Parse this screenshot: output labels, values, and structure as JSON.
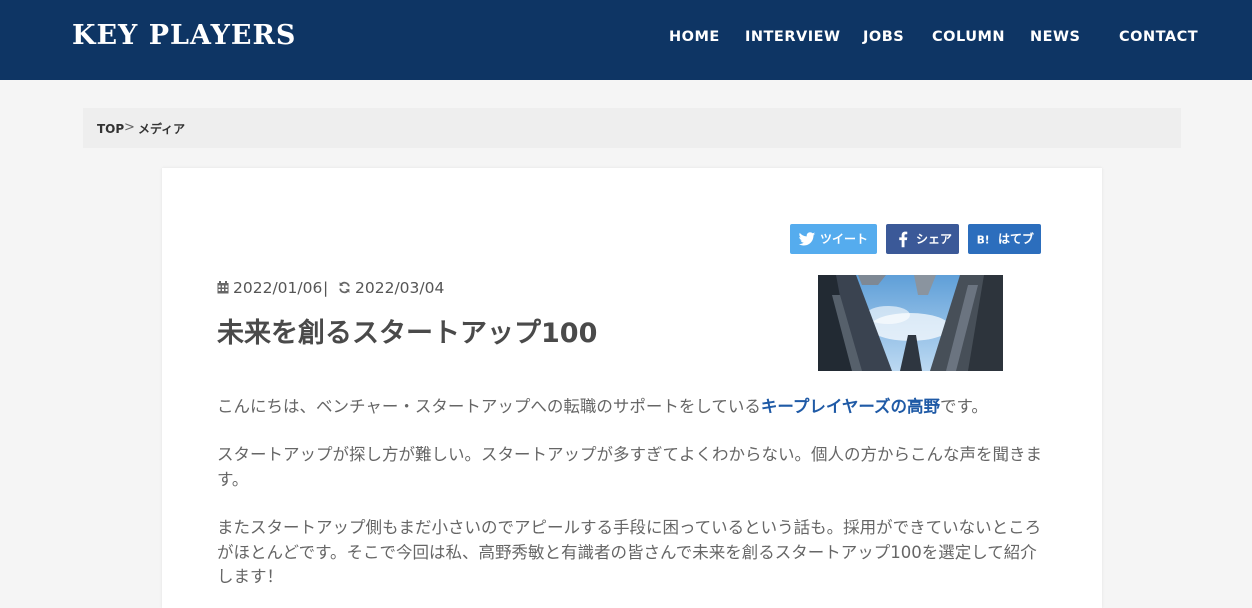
{
  "header": {
    "logo": "KEY PLAYERS",
    "bg_color": "#0e3564",
    "nav": {
      "home": "HOME",
      "interview": "INTERVIEW",
      "jobs": "JOBS",
      "column": "COLUMN",
      "news": "NEWS",
      "contact": "CONTACT"
    }
  },
  "breadcrumb": {
    "top": "TOP",
    "separator": ">",
    "current": "メディア"
  },
  "share": {
    "twitter": "ツイート",
    "facebook": "シェア",
    "hatena": "はてブ",
    "twitter_color": "#55acee",
    "facebook_color": "#3b5998",
    "hatena_color": "#2c6ebd"
  },
  "article": {
    "published": "2022/01/06",
    "divider": "|",
    "updated": "2022/03/04",
    "title": "未来を創るスタートアップ100",
    "intro_before": "こんにちは、ベンチャー・スタートアップへの転職のサポートをしている",
    "intro_link": "キープレイヤーズの高野",
    "intro_after": "です。",
    "para2": "スタートアップが探し方が難しい。スタートアップが多すぎてよくわからない。個人の方からこんな声を聞きます。",
    "para3": "またスタートアップ側もまだ小さいのでアピールする手段に困っているという話も。採用ができていないところがほとんどです。そこで今回は私、高野秀敏と有識者の皆さんで未来を創るスタートアップ100を選定して紹介します！",
    "link_color": "#1f5aa6"
  },
  "icons": {
    "calendar": "calendar-icon",
    "refresh": "refresh-icon",
    "twitter": "twitter-bird-icon",
    "facebook": "facebook-f-icon",
    "hatena": "hatena-bookmark-icon"
  }
}
